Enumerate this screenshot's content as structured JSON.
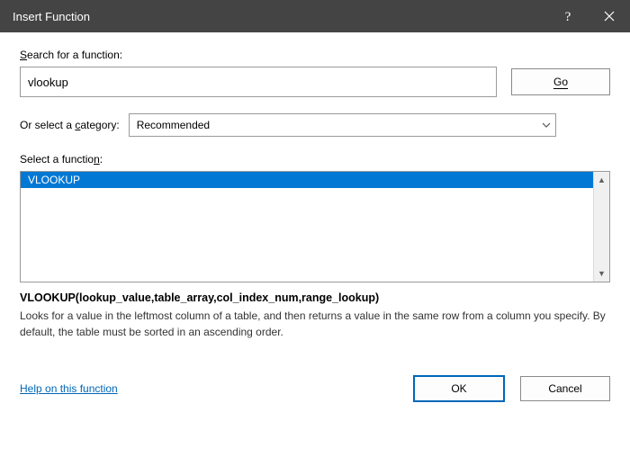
{
  "titlebar": {
    "title": "Insert Function"
  },
  "search": {
    "label_pre": "S",
    "label_post": "earch for a function:",
    "value": "vlookup",
    "go_label": "Go"
  },
  "category": {
    "label_pre": "Or select a ",
    "label_u": "c",
    "label_post": "ategory:",
    "selected": "Recommended"
  },
  "function_list": {
    "label_pre": "Select a functio",
    "label_u": "n",
    "label_post": ":",
    "items": [
      "VLOOKUP"
    ]
  },
  "detail": {
    "signature": "VLOOKUP(lookup_value,table_array,col_index_num,range_lookup)",
    "description": "Looks for a value in the leftmost column of a table, and then returns a value in the same row from a column you specify. By default, the table must be sorted in an ascending order."
  },
  "footer": {
    "help_link": "Help on this function",
    "ok": "OK",
    "cancel": "Cancel"
  }
}
